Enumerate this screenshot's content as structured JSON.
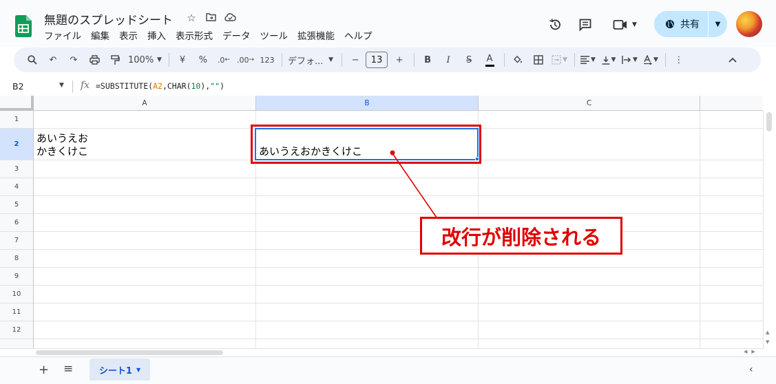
{
  "header": {
    "title": "無題のスプレッドシート",
    "menus": [
      "ファイル",
      "編集",
      "表示",
      "挿入",
      "表示形式",
      "データ",
      "ツール",
      "拡張機能",
      "ヘルプ"
    ],
    "share_label": "共有"
  },
  "toolbar": {
    "zoom": "100%",
    "currency": "¥",
    "percent": "%",
    "dec_decrease": ".0",
    "dec_increase": ".00",
    "number_format": "123",
    "font": "デフォ...",
    "font_size": "13"
  },
  "formula_bar": {
    "cell_ref": "B2",
    "formula_parts": {
      "prefix": "=SUBSTITUTE(",
      "ref": "A2",
      "mid": ",CHAR(",
      "num": "10",
      "close": "),",
      "str": "\"\"",
      "end": ")"
    }
  },
  "grid": {
    "columns": [
      "A",
      "B",
      "C"
    ],
    "rows": [
      "1",
      "2",
      "3",
      "4",
      "5",
      "6",
      "7",
      "8",
      "9",
      "10",
      "11",
      "12"
    ],
    "selected_column": "B",
    "selected_row": "2",
    "cells": {
      "A2_line1": "あいうえお",
      "A2_line2": "かきくけこ",
      "B2": "あいうえおかきくけこ"
    }
  },
  "annotation": {
    "label": "改行が削除される",
    "color": "#e00000"
  },
  "sheets": {
    "active": "シート1"
  },
  "icons": [
    "sheets-logo-icon",
    "star-icon",
    "move-folder-icon",
    "cloud-saved-icon",
    "history-icon",
    "comment-icon",
    "meet-icon",
    "globe-icon",
    "search-menus-icon",
    "undo-icon",
    "redo-icon",
    "print-icon",
    "paint-format-icon",
    "fill-color-icon",
    "borders-icon",
    "merge-icon",
    "align-icon",
    "valign-icon",
    "wrap-icon",
    "rotate-icon",
    "more-icon",
    "collapse-icon",
    "add-sheet-icon",
    "all-sheets-icon",
    "explore-icon"
  ]
}
